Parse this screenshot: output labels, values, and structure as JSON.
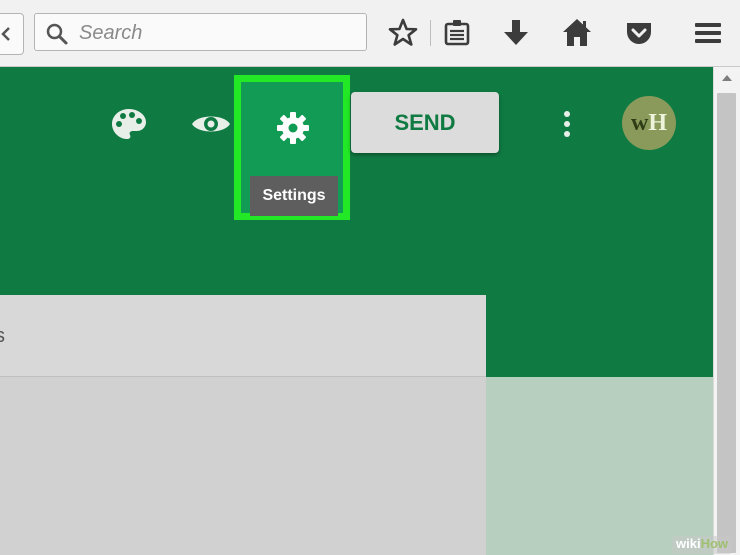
{
  "browser": {
    "search_placeholder": "Search",
    "icons": [
      "back-arrow-icon",
      "search-icon",
      "bookmark-star-icon",
      "reading-list-icon",
      "download-icon",
      "home-icon",
      "pocket-icon",
      "menu-icon"
    ]
  },
  "header": {
    "icons": [
      "palette-icon",
      "eye-icon",
      "gear-icon",
      "more-vert-icon"
    ],
    "settings_tooltip": "Settings",
    "send_label": "SEND",
    "avatar": {
      "initial_1": "w",
      "initial_2": "H"
    }
  },
  "content": {
    "card_sliver_text": "s"
  },
  "watermark": {
    "part1": "wiki",
    "part2": "How"
  },
  "colors": {
    "header_green": "#0f7b43",
    "highlight_green": "#22e826",
    "settings_bg": "#129b54",
    "tooltip_gray": "#5e5e5e",
    "send_bg": "#dcdcdc",
    "avatar_bg": "#8a9a5b",
    "side_panel": "#b6cfbe"
  }
}
